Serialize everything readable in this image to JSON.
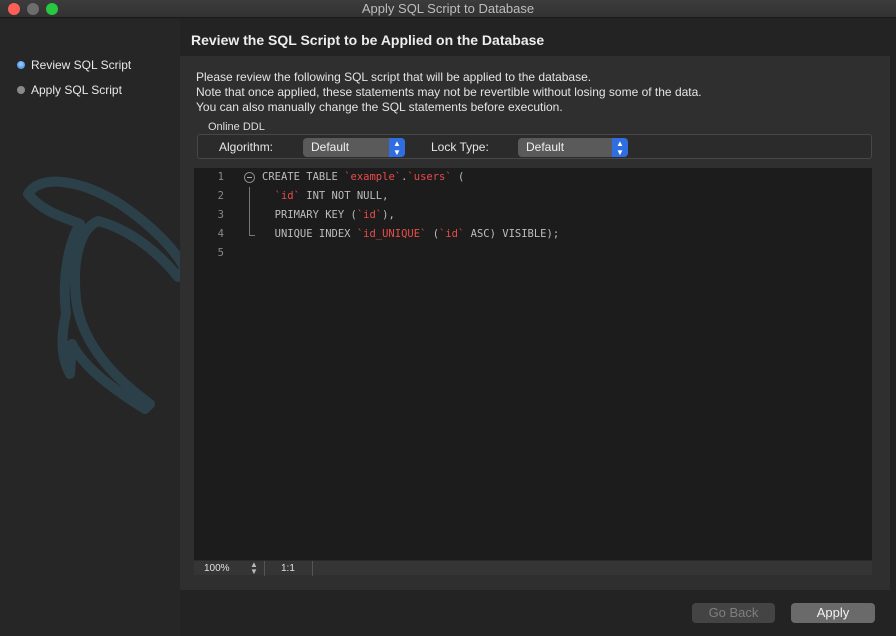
{
  "window": {
    "title": "Apply SQL Script to Database"
  },
  "steps": [
    {
      "label": "Review SQL Script",
      "active": true
    },
    {
      "label": "Apply SQL Script",
      "active": false
    }
  ],
  "heading": "Review the SQL Script to be Applied on the Database",
  "description": [
    "Please review the following SQL script that will be applied to the database.",
    "Note that once applied, these statements may not be revertible without losing some of the data.",
    "You can also manually change the SQL statements before execution."
  ],
  "online_ddl": {
    "label": "Online DDL",
    "algorithm_label": "Algorithm:",
    "algorithm_value": "Default",
    "lock_label": "Lock Type:",
    "lock_value": "Default"
  },
  "editor": {
    "lines": [
      {
        "num": "1",
        "parts": [
          [
            "CREATE TABLE ",
            "kw"
          ],
          [
            "`example`",
            "str"
          ],
          [
            ".",
            "kw"
          ],
          [
            "`users`",
            "str"
          ],
          [
            " (",
            "kw"
          ]
        ]
      },
      {
        "num": "2",
        "parts": [
          [
            "  ",
            "kw"
          ],
          [
            "`id`",
            "str"
          ],
          [
            " INT NOT NULL,",
            "kw"
          ]
        ]
      },
      {
        "num": "3",
        "parts": [
          [
            "  PRIMARY KEY (",
            "kw"
          ],
          [
            "`id`",
            "str"
          ],
          [
            "),",
            "kw"
          ]
        ]
      },
      {
        "num": "4",
        "parts": [
          [
            "  UNIQUE INDEX ",
            "kw"
          ],
          [
            "`id_UNIQUE`",
            "str"
          ],
          [
            " (",
            "kw"
          ],
          [
            "`id`",
            "str"
          ],
          [
            " ASC) VISIBLE);",
            "kw"
          ]
        ]
      },
      {
        "num": "5",
        "parts": []
      }
    ],
    "zoom": "100%",
    "cursor_pos": "1:1"
  },
  "buttons": {
    "back": "Go Back",
    "apply": "Apply"
  },
  "colors": {
    "accent": "#2f6de0",
    "string": "#ea4b4b",
    "close": "#fe5f57",
    "maximize": "#28c840"
  }
}
